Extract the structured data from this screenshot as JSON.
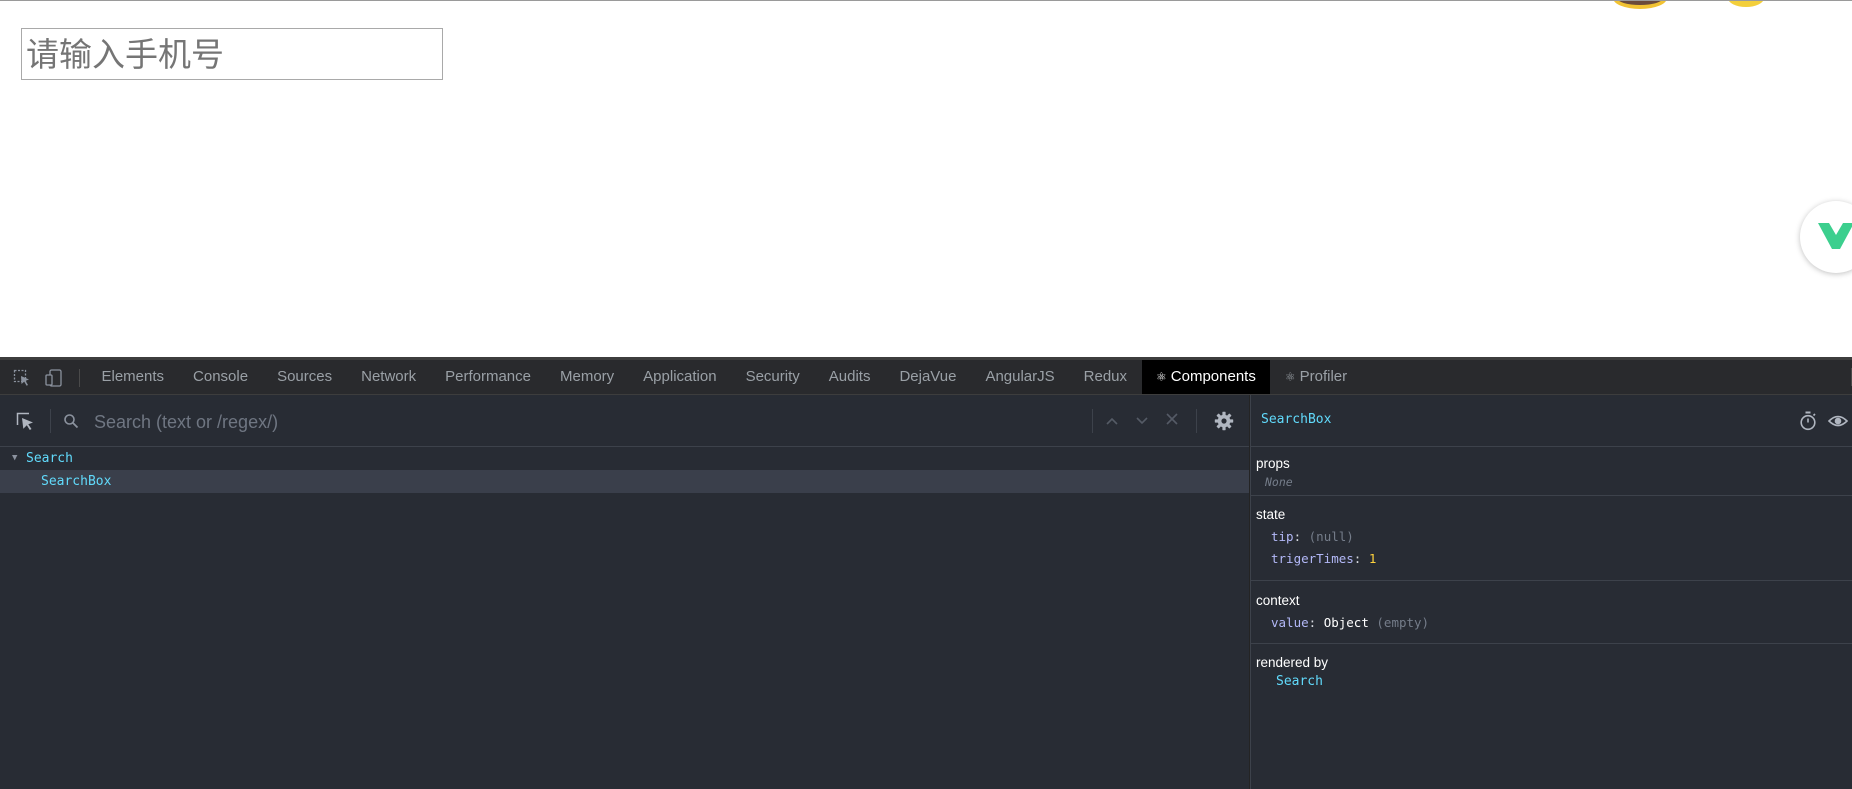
{
  "page": {
    "phone_placeholder": "请输入手机号"
  },
  "devtools": {
    "tabs": [
      {
        "label": "Elements"
      },
      {
        "label": "Console"
      },
      {
        "label": "Sources"
      },
      {
        "label": "Network"
      },
      {
        "label": "Performance"
      },
      {
        "label": "Memory"
      },
      {
        "label": "Application"
      },
      {
        "label": "Security"
      },
      {
        "label": "Audits"
      },
      {
        "label": "DejaVue"
      },
      {
        "label": "AngularJS"
      },
      {
        "label": "Redux"
      },
      {
        "label": "Components",
        "icon": "react-icon",
        "active": true
      },
      {
        "label": "Profiler",
        "icon": "react-icon"
      }
    ],
    "react_icon_glyph": "⚛",
    "search": {
      "placeholder": "Search (text or /regex/)"
    },
    "tree": {
      "root": "Search",
      "child": "SearchBox"
    },
    "inspector": {
      "title": "SearchBox",
      "props": {
        "title": "props",
        "value": "None"
      },
      "state": {
        "title": "state",
        "tip_key": "tip",
        "tip_value": "(null)",
        "triger_key": "trigerTimes",
        "triger_value": "1"
      },
      "context": {
        "title": "context",
        "value_key": "value",
        "value_type": "Object",
        "value_note": "(empty)"
      },
      "rendered_by": {
        "title": "rendered by",
        "owner": "Search"
      },
      "colon": ":"
    },
    "colors": {
      "accent": "#61dafb",
      "panel_bg": "#282c34",
      "number": "#ffd33d"
    }
  }
}
